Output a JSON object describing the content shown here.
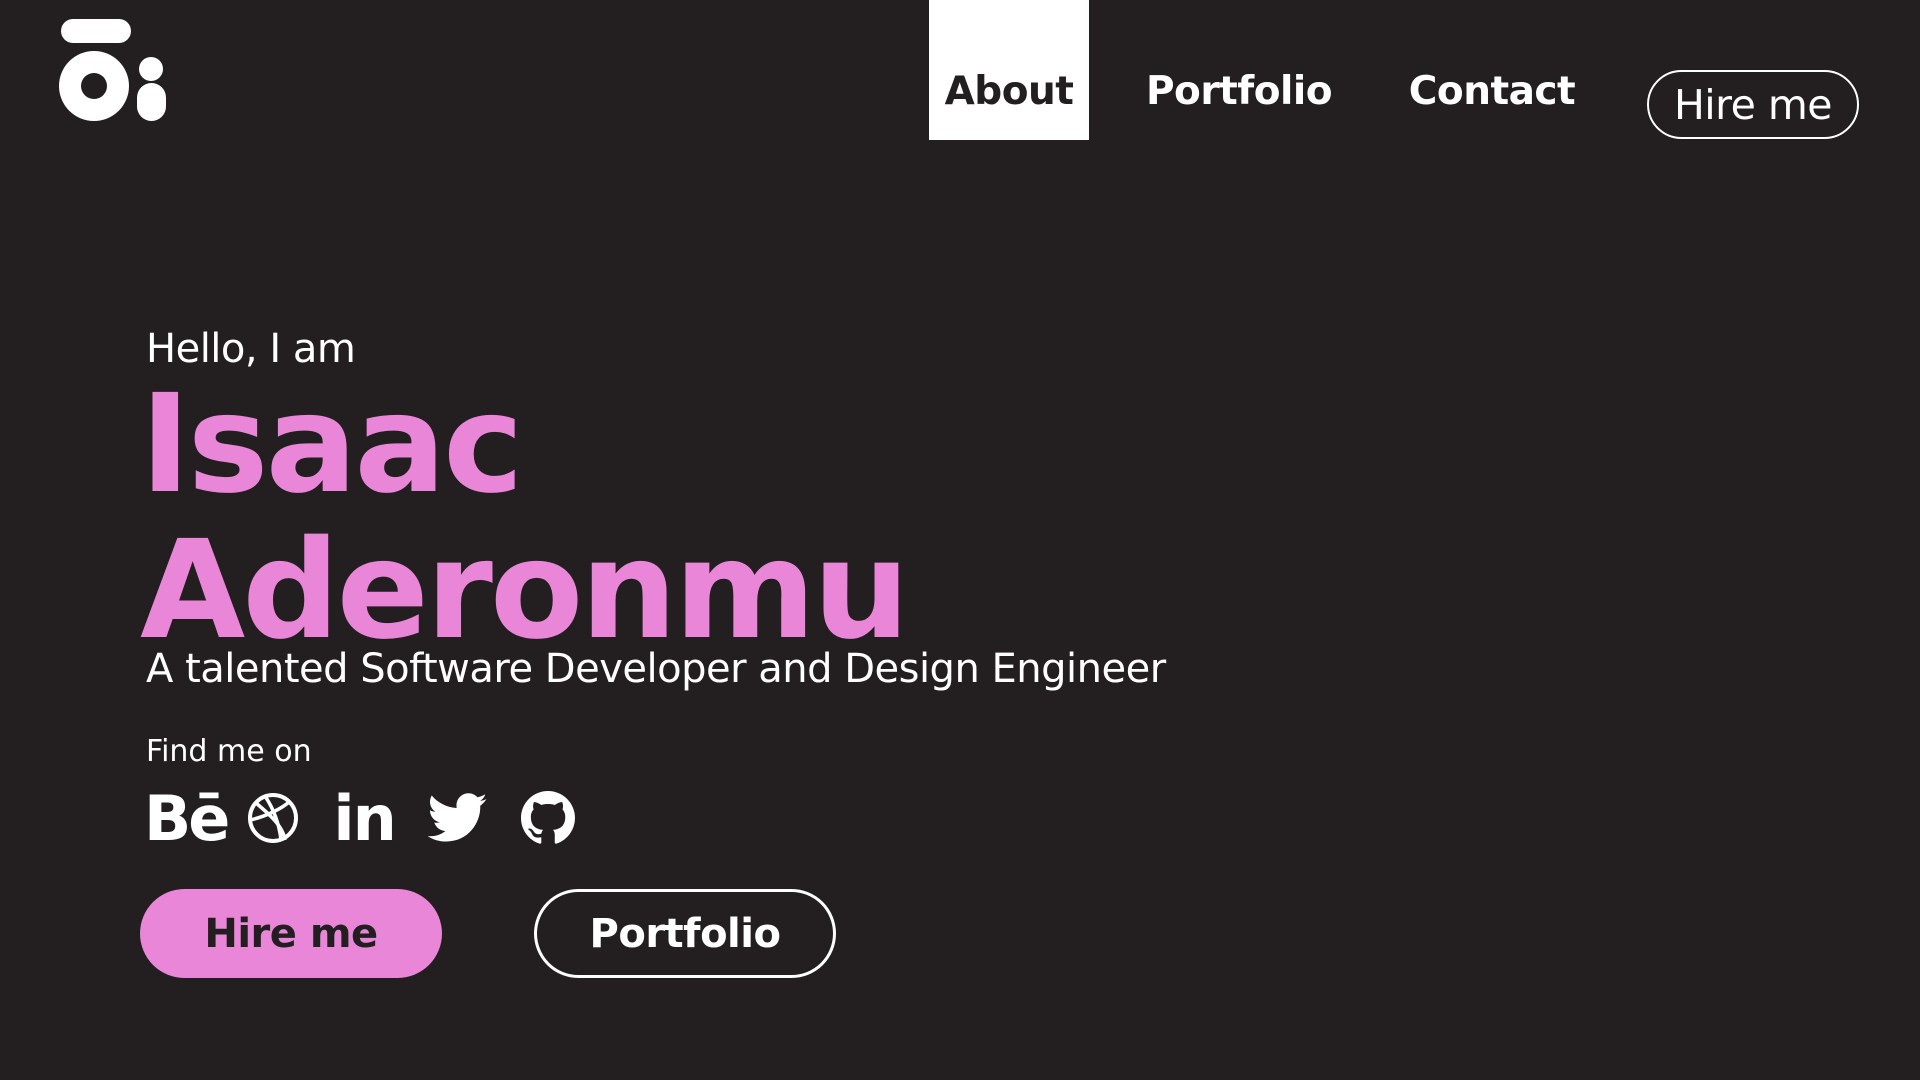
{
  "logo": {
    "icon": "initials-logo-icon"
  },
  "nav": {
    "items": [
      {
        "label": "About",
        "active": true
      },
      {
        "label": "Portfolio",
        "active": false
      },
      {
        "label": "Contact",
        "active": false
      }
    ],
    "hire_label": "Hire me"
  },
  "hero": {
    "greeting": "Hello, I am",
    "first_name": "Isaac",
    "last_name": "Aderonmu",
    "tagline": "A talented Software Developer and Design Engineer",
    "find_label": "Find me on",
    "socials": [
      {
        "icon": "behance-icon",
        "glyph": "Bē"
      },
      {
        "icon": "dribbble-icon"
      },
      {
        "icon": "linkedin-icon",
        "glyph": "in"
      },
      {
        "icon": "twitter-icon"
      },
      {
        "icon": "github-icon"
      }
    ],
    "primary_button": "Hire me",
    "secondary_button": "Portfolio"
  },
  "colors": {
    "background": "#231f20",
    "accent": "#e986d8",
    "text": "#ffffff"
  }
}
